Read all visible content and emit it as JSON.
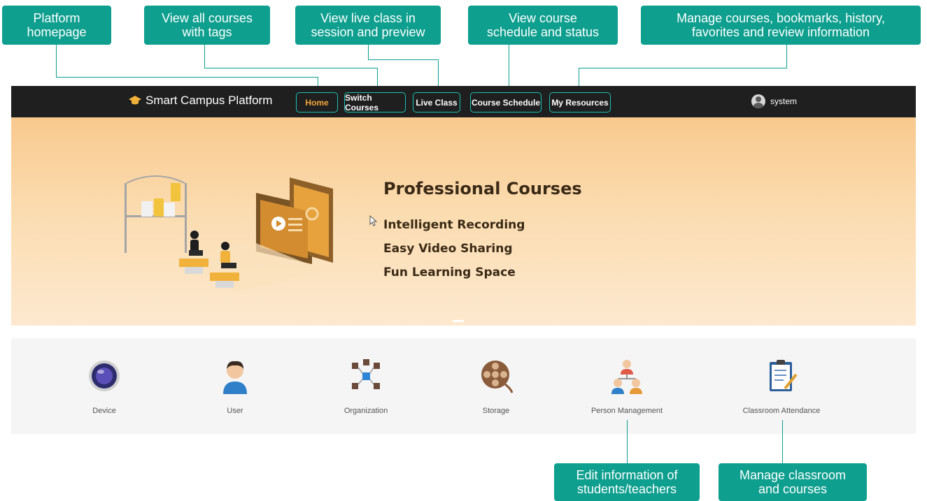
{
  "callouts": {
    "homepage": "Platform\nhomepage",
    "courses": "View all courses\nwith tags",
    "live": "View live class in\nsession and preview",
    "schedule": "View course\nschedule and status",
    "resources": "Manage courses, bookmarks, history,\nfavorites and review information",
    "person": "Edit information of\nstudents/teachers",
    "classroom": "Manage classroom\nand courses"
  },
  "navbar": {
    "brand": "Smart Campus Platform",
    "items": [
      {
        "label": "Home",
        "active": true
      },
      {
        "label": "Switch Courses",
        "active": false
      },
      {
        "label": "Live Class",
        "active": false
      },
      {
        "label": "Course Schedule",
        "active": false
      },
      {
        "label": "My Resources",
        "active": false
      }
    ],
    "user_name": "system"
  },
  "banner": {
    "title": "Professional Courses",
    "lines": [
      "Intelligent Recording",
      "Easy Video Sharing",
      "Fun Learning Space"
    ]
  },
  "modules": [
    {
      "label": "Device",
      "icon": "device-icon"
    },
    {
      "label": "User",
      "icon": "user-icon"
    },
    {
      "label": "Organization",
      "icon": "organization-icon"
    },
    {
      "label": "Storage",
      "icon": "storage-icon"
    },
    {
      "label": "Person Management",
      "icon": "person-management-icon"
    },
    {
      "label": "Classroom Attendance",
      "icon": "classroom-attendance-icon"
    }
  ],
  "colors": {
    "accent": "#0e9f8f",
    "nav_border": "#17c2b2",
    "active_nav": "#f2a53a",
    "navbar_bg": "#1f1f1f"
  }
}
